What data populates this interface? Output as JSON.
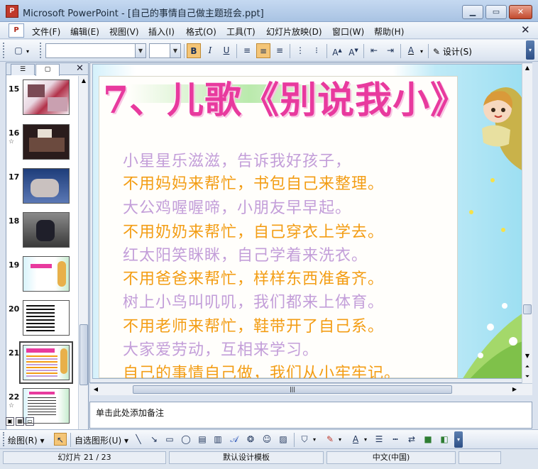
{
  "window": {
    "title": "Microsoft PowerPoint - [自己的事情自己做主题班会.ppt]",
    "app_icon": "P"
  },
  "menu": {
    "items": [
      "文件(F)",
      "编辑(E)",
      "视图(V)",
      "插入(I)",
      "格式(O)",
      "工具(T)",
      "幻灯片放映(D)",
      "窗口(W)",
      "帮助(H)"
    ]
  },
  "toolbar": {
    "font_name": "",
    "font_size": "",
    "bold": "B",
    "italic": "I",
    "underline": "U",
    "design_label": "设计(S)"
  },
  "slides_panel": {
    "slides": [
      {
        "num": "15",
        "star": ""
      },
      {
        "num": "16",
        "star": "☆"
      },
      {
        "num": "17",
        "star": ""
      },
      {
        "num": "18",
        "star": ""
      },
      {
        "num": "19",
        "star": ""
      },
      {
        "num": "20",
        "star": ""
      },
      {
        "num": "21",
        "star": ""
      },
      {
        "num": "22",
        "star": "☆"
      }
    ],
    "selected": "21"
  },
  "slide": {
    "title": "7、儿歌《别说我小》",
    "lines": [
      {
        "text": "小星星乐滋滋，告诉我好孩子，",
        "color": "v"
      },
      {
        "text": "不用妈妈来帮忙，书包自己来整理。",
        "color": "o"
      },
      {
        "text": "大公鸡喔喔啼，小朋友早早起。",
        "color": "v"
      },
      {
        "text": "不用奶奶来帮忙，自己穿衣上学去。",
        "color": "o"
      },
      {
        "text": "红太阳笑眯眯，自己学着来洗衣。",
        "color": "v"
      },
      {
        "text": "不用爸爸来帮忙，样样东西准备齐。",
        "color": "o"
      },
      {
        "text": "树上小鸟叫叽叽，我们都来上体育。",
        "color": "v"
      },
      {
        "text": "不用老师来帮忙，鞋带开了自己系。",
        "color": "o"
      },
      {
        "text": "大家爱劳动，互相来学习。",
        "color": "v"
      },
      {
        "text": "自己的事情自己做，我们从小牢牢记。",
        "color": "o"
      }
    ]
  },
  "notes": {
    "placeholder": "单击此处添加备注"
  },
  "drawing": {
    "draw_label": "绘图(R)",
    "autoshape_label": "自选图形(U)"
  },
  "status": {
    "slide_info": "幻灯片 21 / 23",
    "template": "默认设计模板",
    "language": "中文(中国)"
  },
  "colors": {
    "title_pink": "#e83a9e",
    "violet": "#c39ed9",
    "orange": "#f39d14"
  }
}
